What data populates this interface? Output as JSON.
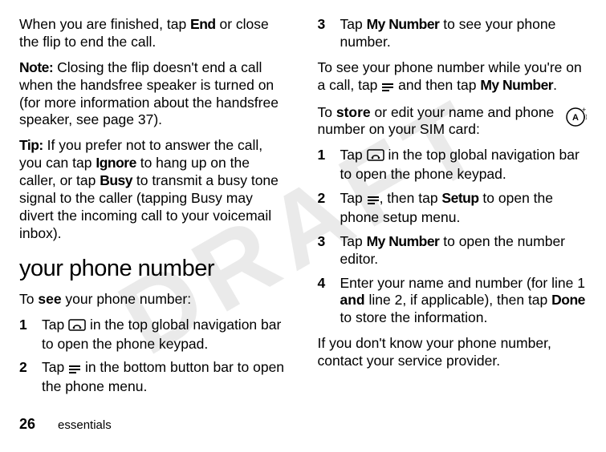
{
  "watermark": "DRAFT",
  "footer": {
    "page": "26",
    "section": "essentials"
  },
  "col1": {
    "p1_a": "When you are finished, tap ",
    "p1_b": "End",
    "p1_c": " or close the flip to end the call.",
    "p2_a": "Note:",
    "p2_b": " Closing the flip doesn't end a call when the handsfree speaker is turned on (for more information about the handsfree speaker, see page 37).",
    "p3_a": "Tip:",
    "p3_b": " If you prefer not to answer the call, you can tap ",
    "p3_c": "Ignore",
    "p3_d": " to hang up on the caller, or tap ",
    "p3_e": "Busy",
    "p3_f": " to transmit a busy tone signal to the caller (tapping Busy may divert the incoming call to your voicemail inbox).",
    "heading": "your phone number",
    "see_a": "To ",
    "see_b": "see",
    "see_c": " your phone number:",
    "s1_a": "Tap ",
    "s1_b": " in the top global navigation bar to open the phone keypad.",
    "s2_a": "Tap ",
    "s2_b": " in the bottom button bar to open the phone menu.",
    "s3_a": "Tap ",
    "s3_b": "My Number",
    "s3_c": " to see your phone number."
  },
  "col2": {
    "p1_a": "To see your phone number while you're on a call, tap ",
    "p1_b": " and then tap ",
    "p1_c": "My Number",
    "p1_d": ".",
    "p2_a": "To ",
    "p2_b": "store",
    "p2_c": " or edit your name and phone number on your SIM card:",
    "s1_a": "Tap ",
    "s1_b": " in the top global navigation bar to open the phone keypad.",
    "s2_a": "Tap ",
    "s2_b": ", then tap ",
    "s2_c": "Setup",
    "s2_d": " to open the phone setup menu.",
    "s3_a": "Tap ",
    "s3_b": "My Number",
    "s3_c": " to open the number editor.",
    "s4_a": "Enter your name and number (for line 1 ",
    "s4_b": "and",
    "s4_c": " line 2, if applicable), then tap ",
    "s4_d": "Done",
    "s4_e": " to store the information.",
    "p3": "If you don't know your phone number, contact your service provider."
  },
  "nums": {
    "n1": "1",
    "n2": "2",
    "n3": "3",
    "n4": "4"
  }
}
